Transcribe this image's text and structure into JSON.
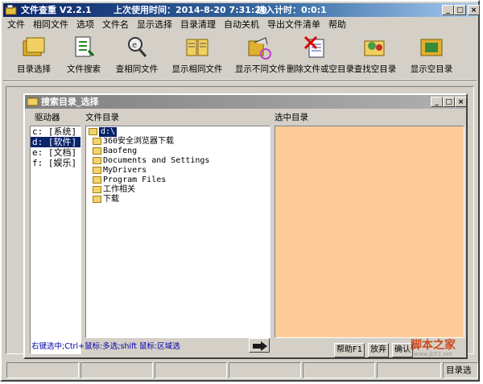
{
  "window": {
    "title": "文件查重 V2.2.1",
    "last_used": "上次使用时间：2014-8-20  7:31:20",
    "timer": "进入计时：0:0:1",
    "controls": [
      "_",
      "□",
      "×"
    ]
  },
  "menu": [
    "文件",
    "相同文件",
    "选项",
    "文件名",
    "显示选择",
    "目录清理",
    "自动关机",
    "导出文件清单",
    "帮助"
  ],
  "toolbar": [
    {
      "label": "目录选择",
      "icon": "folders-icon"
    },
    {
      "label": "文件搜索",
      "icon": "file-search-icon"
    },
    {
      "label": "查相同文件",
      "icon": "same-file-icon"
    },
    {
      "label": "显示相同文件",
      "icon": "show-same-icon"
    },
    {
      "label": "显示不同文件",
      "icon": "show-different-icon"
    },
    {
      "label": "删除文件或空目录",
      "icon": "delete-icon"
    },
    {
      "label": "查找空目录",
      "icon": "find-empty-icon"
    },
    {
      "label": "显示空目录",
      "icon": "show-empty-icon"
    }
  ],
  "dialog": {
    "title": "搜索目录_选择",
    "headers": {
      "drives": "驱动器",
      "dir": "文件目录",
      "selected": "选中目录"
    },
    "drives": [
      "c: [系统]",
      "d: [软件]",
      "e: [文档]",
      "f: [娱乐]"
    ],
    "selected_drive_index": 1,
    "root": "d:\\",
    "folders": [
      "360安全浏览器下载",
      "Baofeng",
      "Documents and Settings",
      "MyDrivers",
      "Program Files",
      "工作相关",
      "下载"
    ],
    "hint": "右键选中;Ctrl+鼠标:多选;shift 鼠标:区域选",
    "buttons": [
      "帮助F1",
      "放弃",
      "确认"
    ]
  },
  "status": {
    "right": "目录选"
  },
  "watermark": {
    "text": "脚本之家",
    "url": "www.jb51.net"
  },
  "colors": {
    "title_blue": "#0a246a",
    "selected_panel": "#ffcc99"
  }
}
